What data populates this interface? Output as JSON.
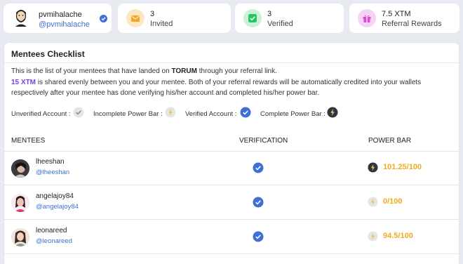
{
  "user": {
    "name": "pvmihalache",
    "handle": "@pvmihalache"
  },
  "stats": [
    {
      "value": "3",
      "label": "Invited",
      "icon": "envelope-icon",
      "color": "#f6a623",
      "bg": "#fde7c2"
    },
    {
      "value": "3",
      "label": "Verified",
      "icon": "check-square-icon",
      "color": "#24c45e",
      "bg": "#c9f3d6"
    },
    {
      "value": "7.5 XTM",
      "label": "Referral Rewards",
      "icon": "gift-icon",
      "color": "#d84fd6",
      "bg": "#f6d3f4"
    }
  ],
  "checklist": {
    "title": "Mentees Checklist",
    "desc_prefix": "This is the list of your mentees that have landed on ",
    "brand": "TORUM",
    "desc_suffix": " through your referral link.",
    "amount": "15 XTM",
    "desc_rest": " is shared evenly between you and your mentee. Both of your referral rewards will be automatically credited into your wallets respectively after your mentee has done verifying his/her account and completed his/her power bar.",
    "legend": [
      {
        "label": "Unverified Account :",
        "icon": "check-grey-icon"
      },
      {
        "label": "Incomplete Power Bar :",
        "icon": "bolt-grey-icon"
      },
      {
        "label": "Verified Account :",
        "icon": "check-blue-icon"
      },
      {
        "label": "Complete Power Bar :",
        "icon": "bolt-dark-icon"
      }
    ]
  },
  "table": {
    "headers": {
      "mentees": "MENTEES",
      "verification": "VERIFICATION",
      "power": "POWER BAR"
    },
    "rows": [
      {
        "name": "lheeshan",
        "handle": "@lheeshan",
        "verified": true,
        "power": "101.25/100",
        "complete": true
      },
      {
        "name": "angelajoy84",
        "handle": "@angelajoy84",
        "verified": true,
        "power": "0/100",
        "complete": false
      },
      {
        "name": "leonareed",
        "handle": "@leonareed",
        "verified": true,
        "power": "94.5/100",
        "complete": false
      }
    ]
  },
  "colors": {
    "accent": "#3f6fd6",
    "power": "#f2a91f",
    "amount": "#7b3ff0"
  }
}
